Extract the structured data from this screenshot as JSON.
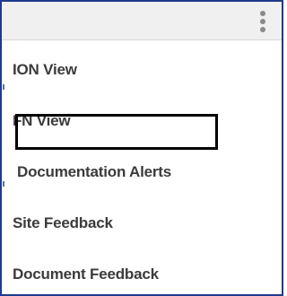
{
  "menu": {
    "items": [
      {
        "label": "ION View"
      },
      {
        "label": "FN View"
      },
      {
        "label": "Documentation Alerts",
        "highlighted": true
      },
      {
        "label": "Site Feedback"
      },
      {
        "label": "Document Feedback"
      }
    ]
  },
  "toolbar": {
    "more_icon": "kebab-vertical-icon"
  },
  "colors": {
    "frame_border": "#1f3a8c",
    "label_text": "#3b3b3b",
    "highlight_border": "#000000",
    "topbar_bg": "#f0f0f0"
  }
}
